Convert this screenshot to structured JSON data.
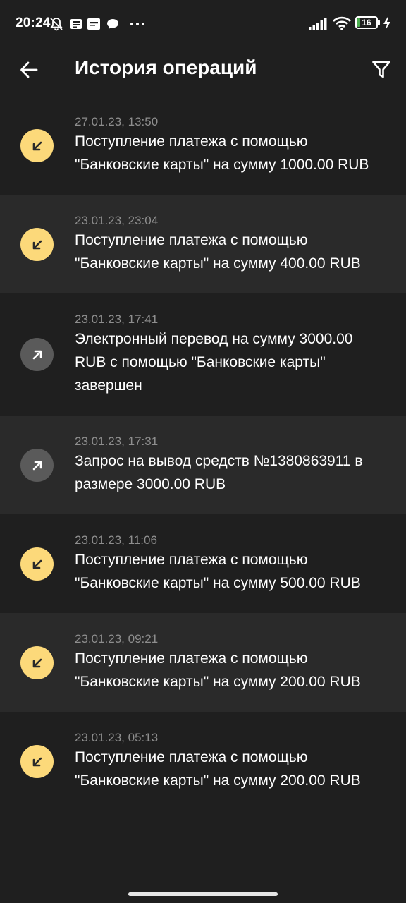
{
  "status_bar": {
    "time": "20:24",
    "battery_level": "16",
    "battery_fraction": 0.16,
    "icons": [
      "bell-off-icon",
      "news-icon",
      "uber-icon",
      "chat-icon",
      "more-dots-icon",
      "signal-icon",
      "wifi-icon",
      "battery-icon",
      "charging-bolt-icon"
    ]
  },
  "header": {
    "title": "История операций",
    "back_icon": "arrow-left-icon",
    "filter_icon": "filter-icon"
  },
  "colors": {
    "background": "#1f1f1f",
    "row_alt": "#2a2a2a",
    "incoming_icon_bg": "#fcd97a",
    "outgoing_icon_bg": "#5a5a5a",
    "date_text": "#8e8e8e"
  },
  "operations": [
    {
      "date": "27.01.23, 13:50",
      "text": "Поступление платежа с помощью \"Банковские карты\" на сумму 1000.00 RUB",
      "direction": "in"
    },
    {
      "date": "23.01.23, 23:04",
      "text": "Поступление платежа с помощью \"Банковские карты\" на сумму 400.00 RUB",
      "direction": "in"
    },
    {
      "date": "23.01.23, 17:41",
      "text": "Электронный перевод на сумму 3000.00 RUB с помощью \"Банковские карты\" завершен",
      "direction": "out"
    },
    {
      "date": "23.01.23, 17:31",
      "text": "Запрос на вывод средств №1380863911 в размере 3000.00 RUB",
      "direction": "out"
    },
    {
      "date": "23.01.23, 11:06",
      "text": "Поступление платежа с помощью \"Банковские карты\" на сумму 500.00 RUB",
      "direction": "in"
    },
    {
      "date": "23.01.23, 09:21",
      "text": "Поступление платежа с помощью \"Банковские карты\" на сумму 200.00 RUB",
      "direction": "in"
    },
    {
      "date": "23.01.23, 05:13",
      "text": "Поступление платежа с помощью \"Банковские карты\" на сумму 200.00 RUB",
      "direction": "in"
    }
  ]
}
